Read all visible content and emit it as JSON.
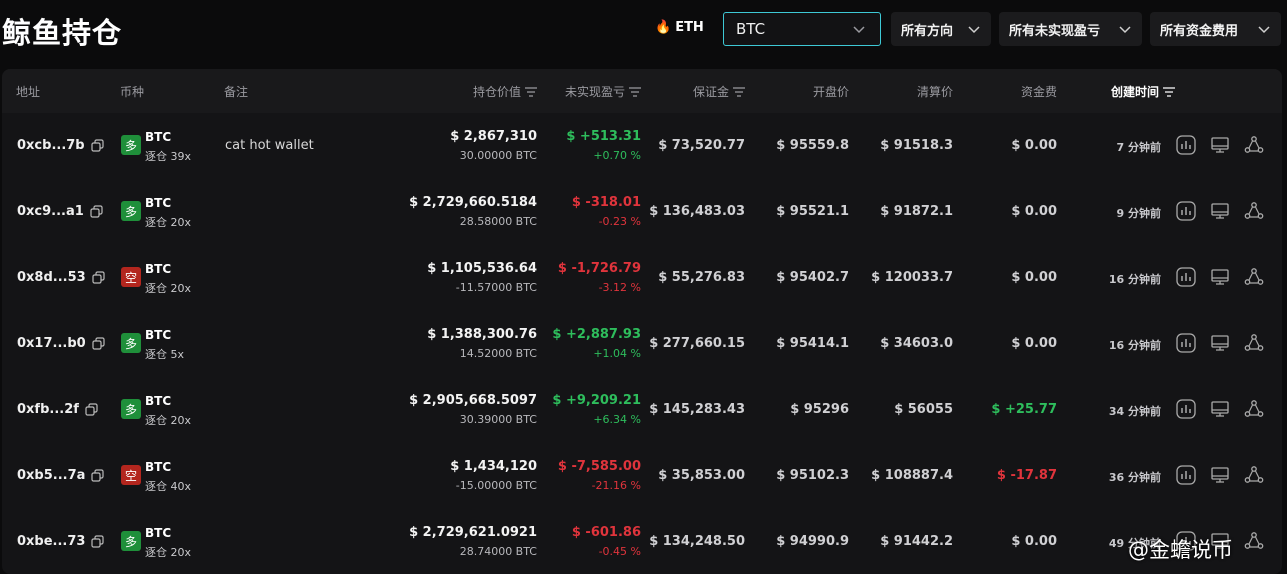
{
  "header": {
    "title": "鲸鱼持仓",
    "eth_label": "ETH",
    "coin_select": {
      "value": "BTC"
    },
    "filters": [
      {
        "label": "所有方向"
      },
      {
        "label": "所有未实现盈亏"
      },
      {
        "label": "所有资金费用"
      }
    ]
  },
  "table": {
    "columns": [
      "地址",
      "币种",
      "备注",
      "持仓价值",
      "未实现盈亏",
      "保证金",
      "开盘价",
      "清算价",
      "资金费",
      "创建时间"
    ],
    "rows": [
      {
        "address": "0xcb...7b",
        "direction": "多",
        "coin": "BTC",
        "leverage": "逐仓 39x",
        "note": "cat hot wallet",
        "value": "$ 2,867,310",
        "size": "30.00000 BTC",
        "pnl": "$ +513.31",
        "pnl_pct": "+0.70 %",
        "margin": "$ 73,520.77",
        "open": "$ 95559.8",
        "liq": "$ 91518.3",
        "funding": "$ 0.00",
        "created": "7 分钟前"
      },
      {
        "address": "0xc9...a1",
        "direction": "多",
        "coin": "BTC",
        "leverage": "逐仓 20x",
        "note": "",
        "value": "$ 2,729,660.5184",
        "size": "28.58000 BTC",
        "pnl": "$ -318.01",
        "pnl_pct": "-0.23 %",
        "margin": "$ 136,483.03",
        "open": "$ 95521.1",
        "liq": "$ 91872.1",
        "funding": "$ 0.00",
        "created": "9 分钟前"
      },
      {
        "address": "0x8d...53",
        "direction": "空",
        "coin": "BTC",
        "leverage": "逐仓 20x",
        "note": "",
        "value": "$ 1,105,536.64",
        "size": "-11.57000 BTC",
        "pnl": "$ -1,726.79",
        "pnl_pct": "-3.12 %",
        "margin": "$ 55,276.83",
        "open": "$ 95402.7",
        "liq": "$ 120033.7",
        "funding": "$ 0.00",
        "created": "16 分钟前"
      },
      {
        "address": "0x17...b0",
        "direction": "多",
        "coin": "BTC",
        "leverage": "逐仓 5x",
        "note": "",
        "value": "$ 1,388,300.76",
        "size": "14.52000 BTC",
        "pnl": "$ +2,887.93",
        "pnl_pct": "+1.04 %",
        "margin": "$ 277,660.15",
        "open": "$ 95414.1",
        "liq": "$ 34603.0",
        "funding": "$ 0.00",
        "created": "16 分钟前"
      },
      {
        "address": "0xfb...2f",
        "direction": "多",
        "coin": "BTC",
        "leverage": "逐仓 20x",
        "note": "",
        "value": "$ 2,905,668.5097",
        "size": "30.39000 BTC",
        "pnl": "$ +9,209.21",
        "pnl_pct": "+6.34 %",
        "margin": "$ 145,283.43",
        "open": "$ 95296",
        "liq": "$ 56055",
        "funding": "$ +25.77",
        "created": "34 分钟前"
      },
      {
        "address": "0xb5...7a",
        "direction": "空",
        "coin": "BTC",
        "leverage": "逐仓 40x",
        "note": "",
        "value": "$ 1,434,120",
        "size": "-15.00000 BTC",
        "pnl": "$ -7,585.00",
        "pnl_pct": "-21.16 %",
        "margin": "$ 35,853.00",
        "open": "$ 95102.3",
        "liq": "$ 108887.4",
        "funding": "$ -17.87",
        "created": "36 分钟前"
      },
      {
        "address": "0xbe...73",
        "direction": "多",
        "coin": "BTC",
        "leverage": "逐仓 20x",
        "note": "",
        "value": "$ 2,729,621.0921",
        "size": "28.74000 BTC",
        "pnl": "$ -601.86",
        "pnl_pct": "-0.45 %",
        "margin": "$ 134,248.50",
        "open": "$ 94990.9",
        "liq": "$ 91442.2",
        "funding": "$ 0.00",
        "created": "49 分钟前"
      }
    ]
  },
  "watermark": "@金蟾说币",
  "colors": {
    "long": "#1f8f3a",
    "short": "#b3261e",
    "positive": "#2ebd5c",
    "negative": "#e0343c",
    "accent": "#3ec9d6"
  },
  "icons": [
    "flame-icon",
    "chevron-down-icon",
    "sort-icon",
    "copy-icon",
    "chart-icon",
    "monitor-icon",
    "share-icon"
  ]
}
